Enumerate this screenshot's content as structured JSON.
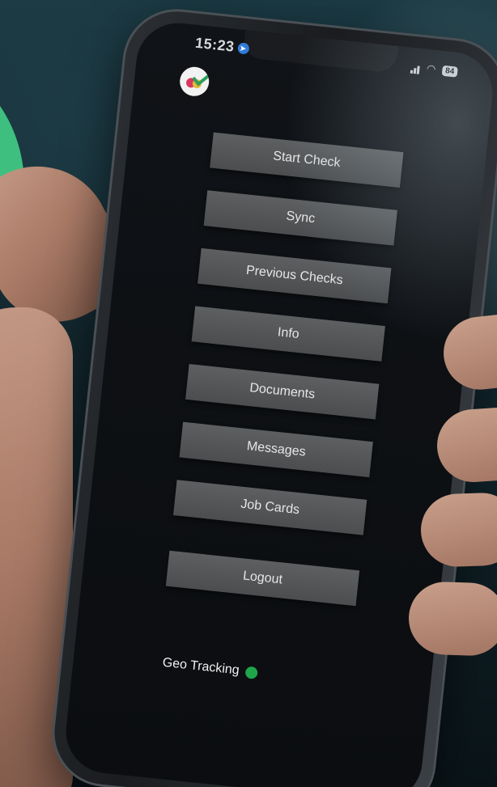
{
  "status_bar": {
    "time": "15:23",
    "battery": "84"
  },
  "menu": {
    "items": [
      {
        "label": "Start Check"
      },
      {
        "label": "Sync"
      },
      {
        "label": "Previous Checks"
      },
      {
        "label": "Info"
      },
      {
        "label": "Documents"
      },
      {
        "label": "Messages"
      },
      {
        "label": "Job Cards"
      },
      {
        "label": "Logout"
      }
    ]
  },
  "geo_tracking": {
    "label": "Geo Tracking",
    "status_color": "#1fa54a"
  },
  "colors": {
    "accent_green": "#3fbf7f",
    "button_bg": "#555759"
  }
}
